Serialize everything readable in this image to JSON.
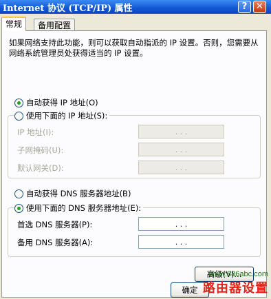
{
  "window": {
    "title": "Internet 协议 (TCP/IP) 属性",
    "help_label": "?",
    "close_label": "✕"
  },
  "tabs": [
    {
      "label": "常规"
    },
    {
      "label": "备用配置"
    }
  ],
  "description": "如果网络支持此功能，则可以获取自动指派的 IP 设置。否则，您需要从网络系统管理员处获得适当的 IP 设置。",
  "ip_section": {
    "auto_label": "自动获得 IP 地址(O)",
    "manual_label": "使用下面的 IP 地址(S):",
    "selected": "auto",
    "fields": [
      {
        "label": "IP 地址(I):",
        "value": ". . ."
      },
      {
        "label": "子网掩码(U):",
        "value": ". . ."
      },
      {
        "label": "默认网关(D):",
        "value": ". . ."
      }
    ]
  },
  "dns_section": {
    "auto_label": "自动获得 DNS 服务器地址(B)",
    "manual_label": "使用下面的 DNS 服务器地址(E):",
    "selected": "manual",
    "fields": [
      {
        "label": "首选 DNS 服务器(P):",
        "value": ". . ."
      },
      {
        "label": "备用 DNS 服务器(A):",
        "value": ". . ."
      }
    ]
  },
  "buttons": {
    "advanced": "高级(V)...",
    "ok": "确定"
  },
  "watermark": {
    "url": "www.886abc.com",
    "brand": "路由器设置"
  }
}
